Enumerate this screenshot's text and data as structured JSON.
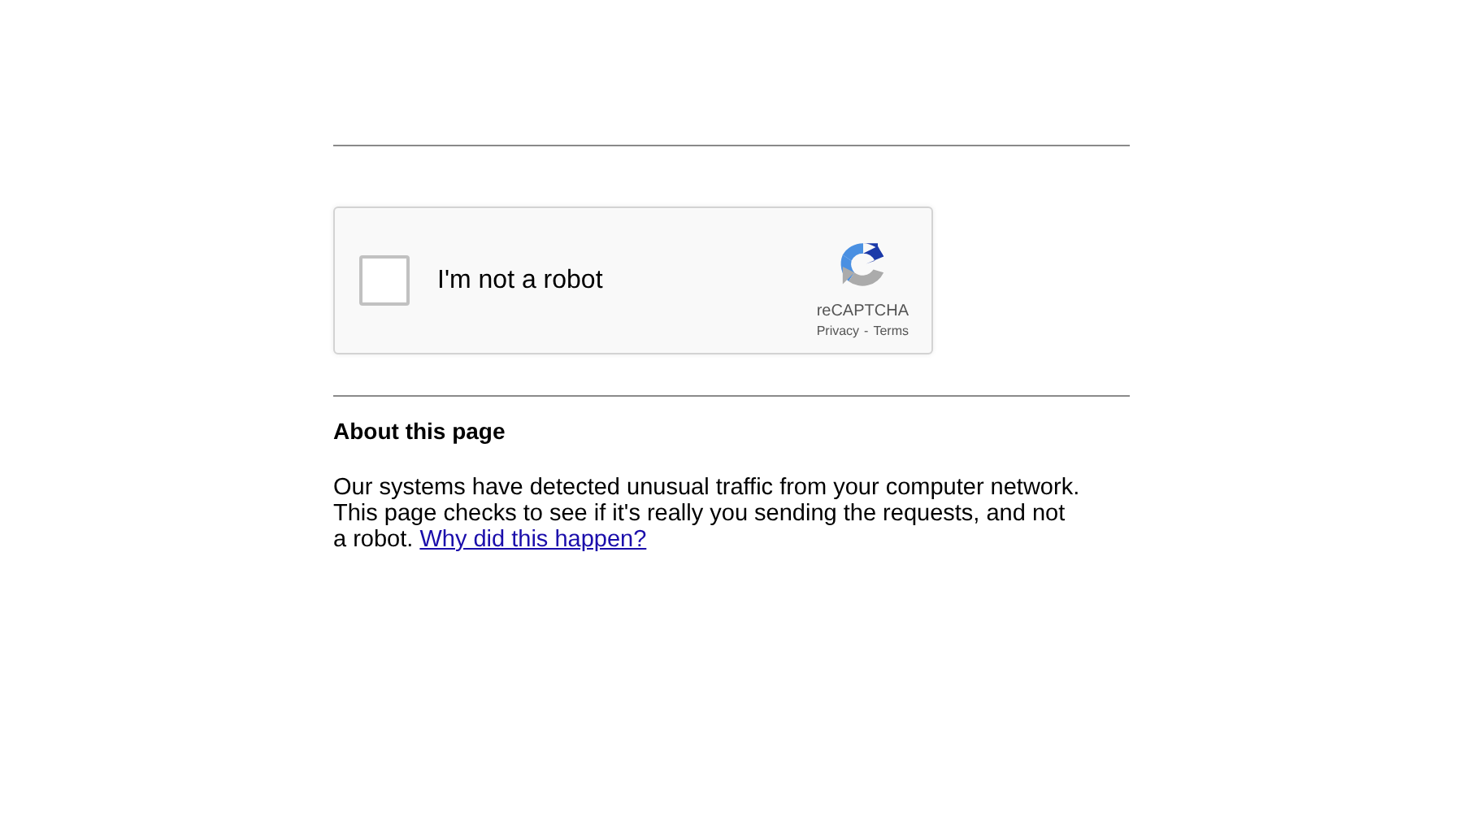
{
  "captcha": {
    "label": "I'm not a robot",
    "checked": false,
    "brand": "reCAPTCHA",
    "privacy": "Privacy",
    "separator": "-",
    "terms": "Terms"
  },
  "about": {
    "heading": "About this page",
    "text": "Our systems have detected unusual traffic from your computer network. This page checks to see if it's really you sending the requests, and not a robot.",
    "link": "Why did this happen?"
  }
}
